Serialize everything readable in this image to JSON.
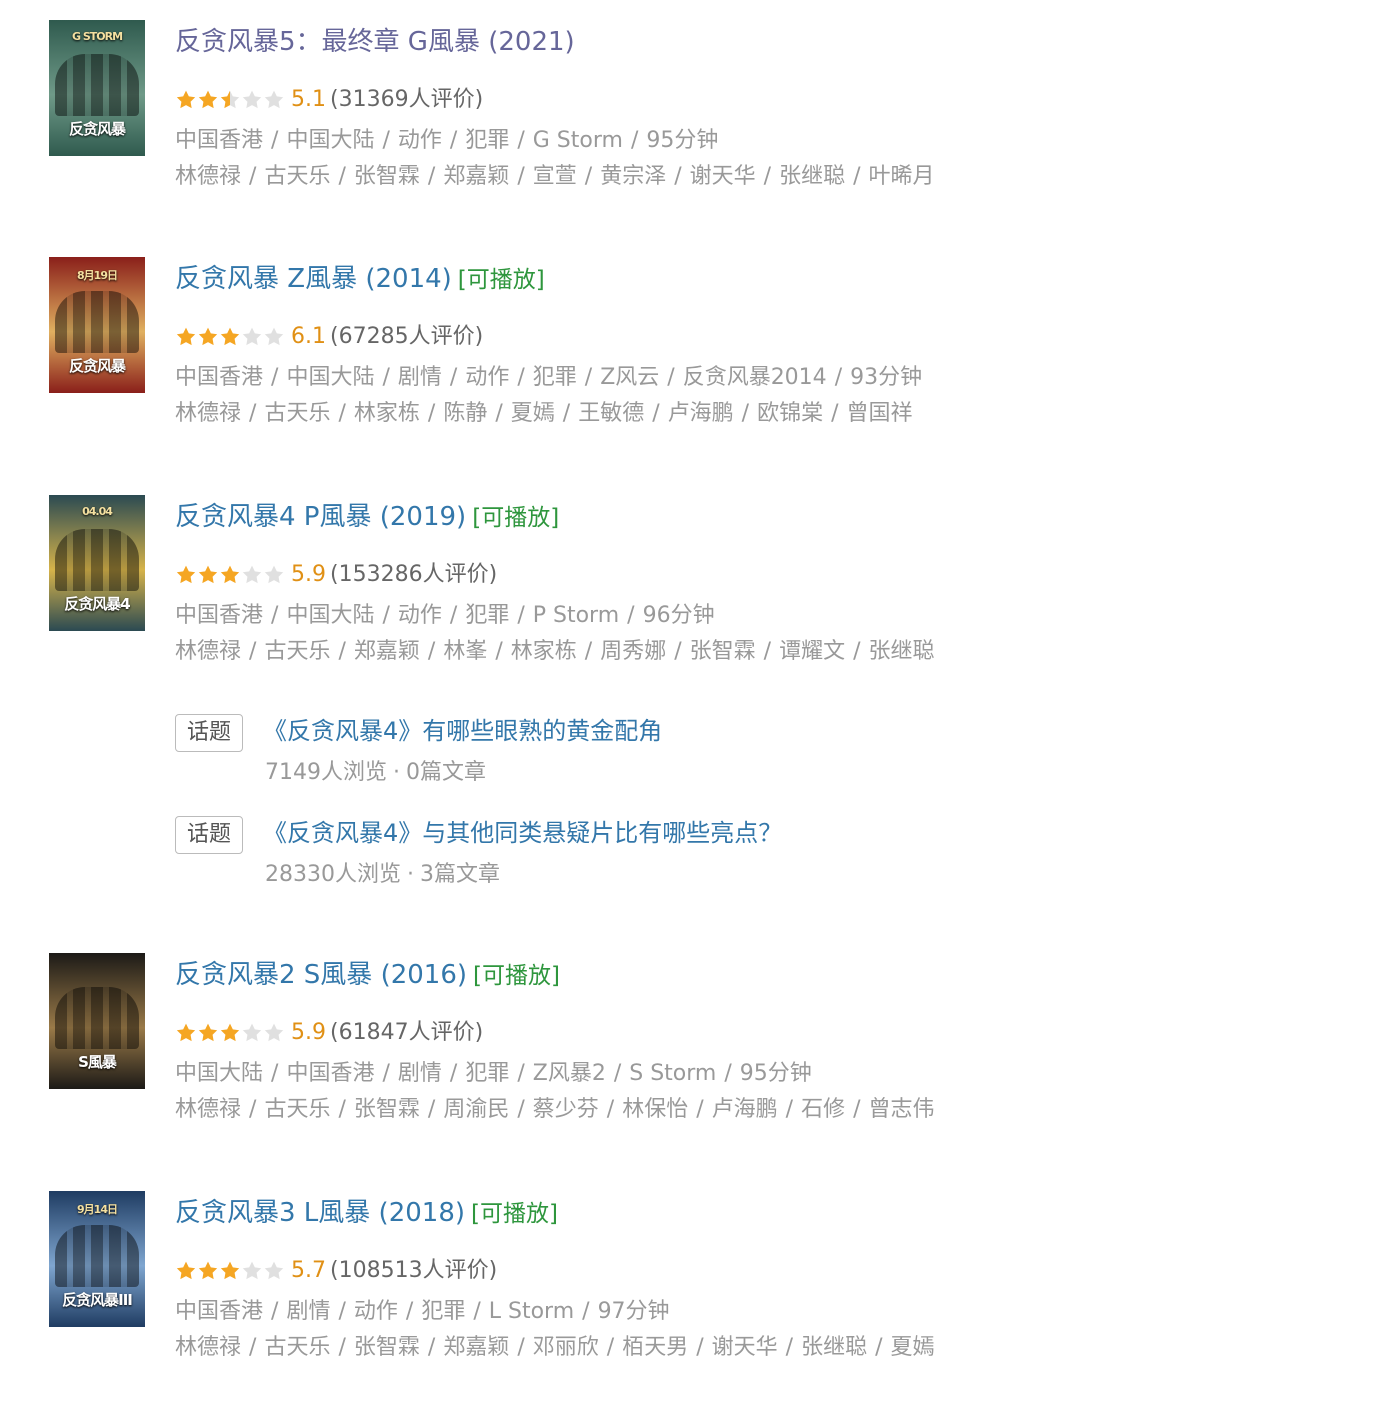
{
  "movies": [
    {
      "title": "反贪风暴5：最终章 G風暴 (2021)",
      "playable": "",
      "score": "5.1",
      "stars": [
        1,
        1,
        0.5,
        0,
        0
      ],
      "count": "(31369人评价)",
      "info": [
        "中国香港",
        "中国大陆",
        "动作",
        "犯罪",
        "G Storm",
        "95分钟"
      ],
      "cast": [
        "林德禄",
        "古天乐",
        "张智霖",
        "郑嘉颖",
        "宣萱",
        "黄宗泽",
        "谢天华",
        "张继聪",
        "叶晞月"
      ],
      "poster": {
        "bg": "#2f5a4e",
        "accent": "#6f9a88",
        "caption": "反贪风暴",
        "sub": "G STORM"
      }
    },
    {
      "title": "反贪风暴 Z風暴 (2014)",
      "playable": "[可播放]",
      "score": "6.1",
      "stars": [
        1,
        1,
        1,
        0,
        0
      ],
      "count": "(67285人评价)",
      "info": [
        "中国香港",
        "中国大陆",
        "剧情",
        "动作",
        "犯罪",
        "Z风云",
        "反贪风暴2014",
        "93分钟"
      ],
      "cast": [
        "林德禄",
        "古天乐",
        "林家栋",
        "陈静",
        "夏嫣",
        "王敏德",
        "卢海鹏",
        "欧锦棠",
        "曾国祥"
      ],
      "poster": {
        "bg": "#8a1f1a",
        "accent": "#e0b060",
        "caption": "反贪风暴",
        "sub": "8月19日"
      }
    },
    {
      "title": "反贪风暴4 P風暴 (2019)",
      "playable": "[可播放]",
      "score": "5.9",
      "stars": [
        1,
        1,
        1,
        0,
        0
      ],
      "count": "(153286人评价)",
      "info": [
        "中国香港",
        "中国大陆",
        "动作",
        "犯罪",
        "P Storm",
        "96分钟"
      ],
      "cast": [
        "林德禄",
        "古天乐",
        "郑嘉颖",
        "林峯",
        "林家栋",
        "周秀娜",
        "张智霖",
        "谭耀文",
        "张继聪"
      ],
      "poster": {
        "bg": "#2b4a52",
        "accent": "#d6b34a",
        "caption": "反贪风暴4",
        "sub": "04.04"
      }
    },
    {
      "title": "反贪风暴2 S風暴 (2016)",
      "playable": "[可播放]",
      "score": "5.9",
      "stars": [
        1,
        1,
        1,
        0,
        0
      ],
      "count": "(61847人评价)",
      "info": [
        "中国大陆",
        "中国香港",
        "剧情",
        "犯罪",
        "Z风暴2",
        "S Storm",
        "95分钟"
      ],
      "cast": [
        "林德禄",
        "古天乐",
        "张智霖",
        "周渝民",
        "蔡少芬",
        "林保怡",
        "卢海鹏",
        "石修",
        "曾志伟"
      ],
      "poster": {
        "bg": "#1c1a17",
        "accent": "#9a7a48",
        "caption": "S風暴",
        "sub": ""
      }
    },
    {
      "title": "反贪风暴3 L風暴 (2018)",
      "playable": "[可播放]",
      "score": "5.7",
      "stars": [
        1,
        1,
        1,
        0,
        0
      ],
      "count": "(108513人评价)",
      "info": [
        "中国香港",
        "剧情",
        "动作",
        "犯罪",
        "L Storm",
        "97分钟"
      ],
      "cast": [
        "林德禄",
        "古天乐",
        "张智霖",
        "郑嘉颖",
        "邓丽欣",
        "栢天男",
        "谢天华",
        "张继聪",
        "夏嫣"
      ],
      "poster": {
        "bg": "#1f3c62",
        "accent": "#7fa6d0",
        "caption": "反贪风暴III",
        "sub": "9月14日"
      }
    }
  ],
  "topics": [
    {
      "tag": "话题",
      "title": "《反贪风暴4》有哪些眼熟的黄金配角",
      "views": "7149人浏览",
      "articles": "0篇文章"
    },
    {
      "tag": "话题",
      "title": "《反贪风暴4》与其他同类悬疑片比有哪些亮点？",
      "views": "28330人浏览",
      "articles": "3篇文章"
    }
  ],
  "separator": "/",
  "dot": "·",
  "colors": {
    "link": "#3377aa",
    "visited_link": "#666699",
    "playable": "#2e963d",
    "star_on": "#f5a623",
    "star_off": "#e0e0e0",
    "score": "#e09015",
    "meta": "#999999"
  }
}
